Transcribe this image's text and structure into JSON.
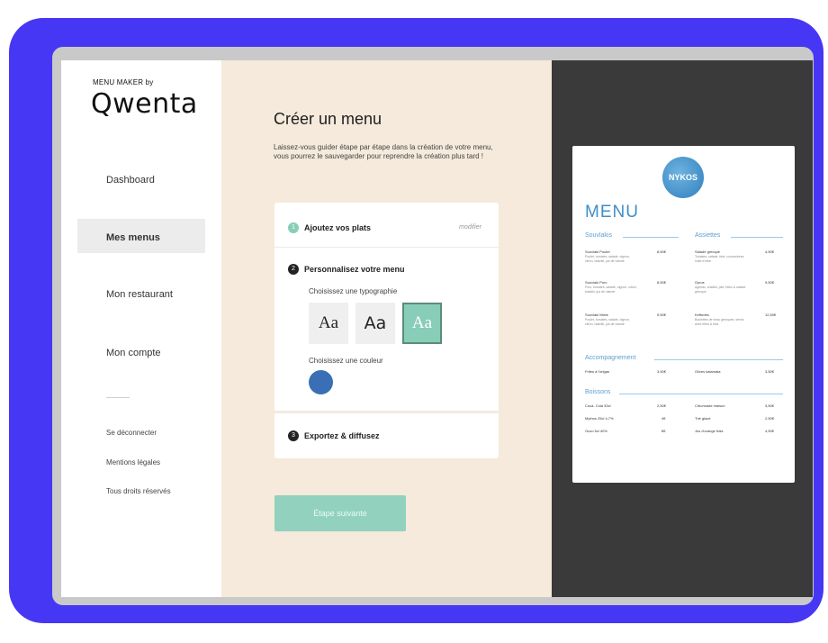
{
  "brand": {
    "small": "MENU MAKER by",
    "logo": "Qwenta"
  },
  "sidebar": {
    "items": [
      {
        "label": "Dashboard"
      },
      {
        "label": "Mes menus"
      },
      {
        "label": "Mon restaurant"
      },
      {
        "label": "Mon compte"
      }
    ],
    "active_index": 1,
    "secondary": [
      {
        "label": "Se déconnecter"
      },
      {
        "label": "Mentions légales"
      },
      {
        "label": "Tous droits réservés"
      }
    ]
  },
  "main": {
    "title": "Créer un menu",
    "description": "Laissez-vous guider étape par étape dans la création de votre menu, vous pourrez le sauvegarder pour reprendre la création plus tard !",
    "steps": [
      {
        "number": "1",
        "label": "Ajoutez vos plats",
        "action": "modifier",
        "color": "#88cdb7"
      },
      {
        "number": "2",
        "label": "Personnalisez votre menu",
        "color": "#222222"
      },
      {
        "number": "3",
        "label": "Exportez & diffusez",
        "color": "#222222"
      }
    ],
    "typography_label": "Choisissez une typographie",
    "fonts": [
      {
        "sample": "Aa",
        "selected": false
      },
      {
        "sample": "Aa",
        "selected": false
      },
      {
        "sample": "Aa",
        "selected": true
      }
    ],
    "color_label": "Choisissez une couleur",
    "selected_color": "#3a6fb5",
    "next_button": "Étape suivante"
  },
  "preview": {
    "logo_text": "NYKOS",
    "title": "MENU",
    "sections": {
      "souvlakis": {
        "heading": "Souvlakis",
        "items": [
          {
            "name": "Souvlaki Poulet",
            "price": "8,50€",
            "desc": "Poulet, tomates, salade, oignon, citron, tzatziki, jus de viande"
          },
          {
            "name": "Souvlaki Porc",
            "price": "8,50€",
            "desc": "Porc, tomates, salade, oignon, citron, tzatziki, jus de viande"
          },
          {
            "name": "Souvlaki Mixte",
            "price": "9,50€",
            "desc": "Poulet, tomates, salade, oignon, citron, tzatziki, jus de viande"
          }
        ]
      },
      "assiettes": {
        "heading": "Assiettes",
        "items": [
          {
            "name": "Salade grecque",
            "price": "4,50€",
            "desc": "Tomates, salade, feta, concombres, huile d'olive"
          },
          {
            "name": "Gyros",
            "price": "9,50€",
            "desc": "Agneau, tzatziki, pita, frites & salade grecque"
          },
          {
            "name": "Keftedes",
            "price": "12,50€",
            "desc": "Boulettes de veau grecques, servis avec frites & feta"
          }
        ]
      },
      "accompagnements": {
        "heading": "Accompagnement",
        "items": [
          {
            "name": "Frites à l'origan",
            "price": "3,50€"
          },
          {
            "name": "Olives kalamata",
            "price": "3,50€"
          }
        ]
      },
      "boissons": {
        "heading": "Boissons",
        "items": [
          {
            "name": "Coca- Cola 33cl",
            "price": "2,50€"
          },
          {
            "name": "Citronnade maison",
            "price": "3,50€"
          },
          {
            "name": "Mythos 25cl 4,7%",
            "price": "4€"
          },
          {
            "name": "Thé glacé",
            "price": "2,50€"
          },
          {
            "name": "Ouzo 5cl 40%",
            "price": "8€"
          },
          {
            "name": "Jus d'orange frais",
            "price": "4,50€"
          }
        ]
      }
    }
  }
}
